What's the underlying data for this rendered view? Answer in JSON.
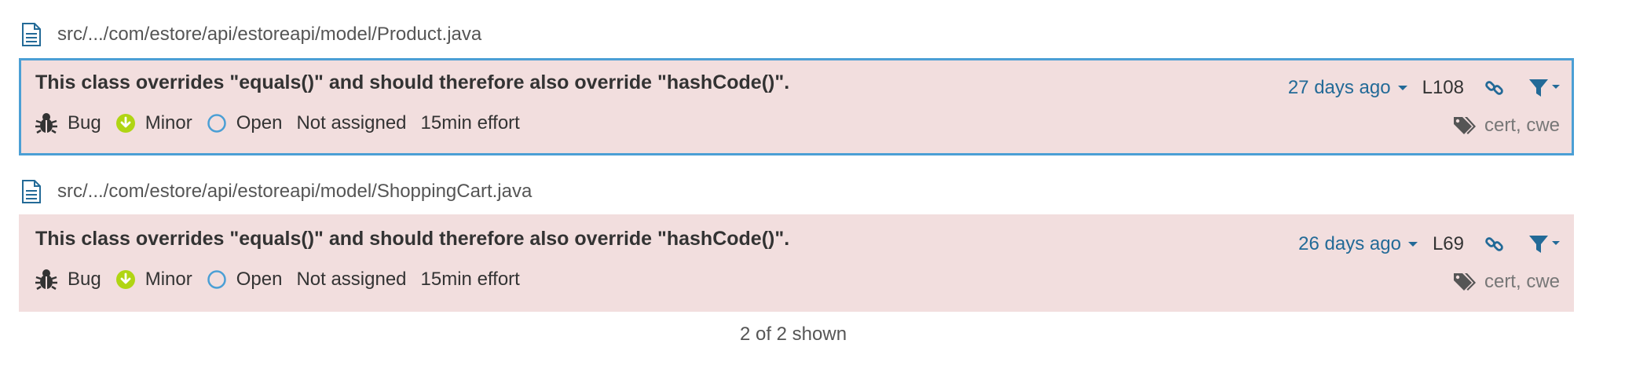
{
  "issues": [
    {
      "file_path": "src/.../com/estore/api/estoreapi/model/Product.java",
      "message": "This class overrides \"equals()\" and should therefore also override \"hashCode()\".",
      "type": "Bug",
      "severity": "Minor",
      "status": "Open",
      "assignee": "Not assigned",
      "effort": "15min effort",
      "age": "27 days ago",
      "line": "L108",
      "tags": "cert, cwe",
      "selected": true
    },
    {
      "file_path": "src/.../com/estore/api/estoreapi/model/ShoppingCart.java",
      "message": "This class overrides \"equals()\" and should therefore also override \"hashCode()\".",
      "type": "Bug",
      "severity": "Minor",
      "status": "Open",
      "assignee": "Not assigned",
      "effort": "15min effort",
      "age": "26 days ago",
      "line": "L69",
      "tags": "cert, cwe",
      "selected": false
    }
  ],
  "footer": {
    "count_text": "2 of 2 shown"
  },
  "colors": {
    "issue_bg": "#f2dede",
    "selected_border": "#4b9fd5",
    "link_blue": "#236a97",
    "minor_green": "#b0d513",
    "status_blue": "#4b9fd5"
  }
}
